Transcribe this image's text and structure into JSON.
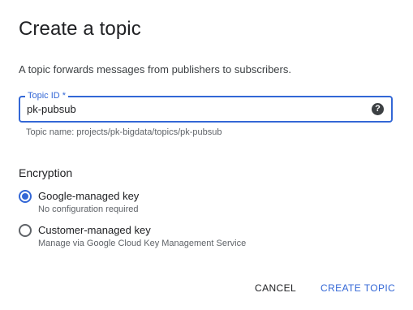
{
  "dialog": {
    "title": "Create a topic",
    "description": "A topic forwards messages from publishers to subscribers."
  },
  "topic_id": {
    "label": "Topic ID *",
    "value": "pk-pubsub",
    "help_icon": "help-circle-icon",
    "help_glyph": "?",
    "hint": "Topic name: projects/pk-bigdata/topics/pk-pubsub"
  },
  "encryption": {
    "title": "Encryption",
    "options": [
      {
        "label": "Google-managed key",
        "sublabel": "No configuration required",
        "selected": true
      },
      {
        "label": "Customer-managed key",
        "sublabel": "Manage via Google Cloud Key Management Service",
        "selected": false
      }
    ]
  },
  "actions": {
    "cancel_label": "CANCEL",
    "create_label": "CREATE TOPIC"
  },
  "colors": {
    "accent": "#3367d6",
    "text": "#202124",
    "secondary_text": "#5f6368"
  }
}
